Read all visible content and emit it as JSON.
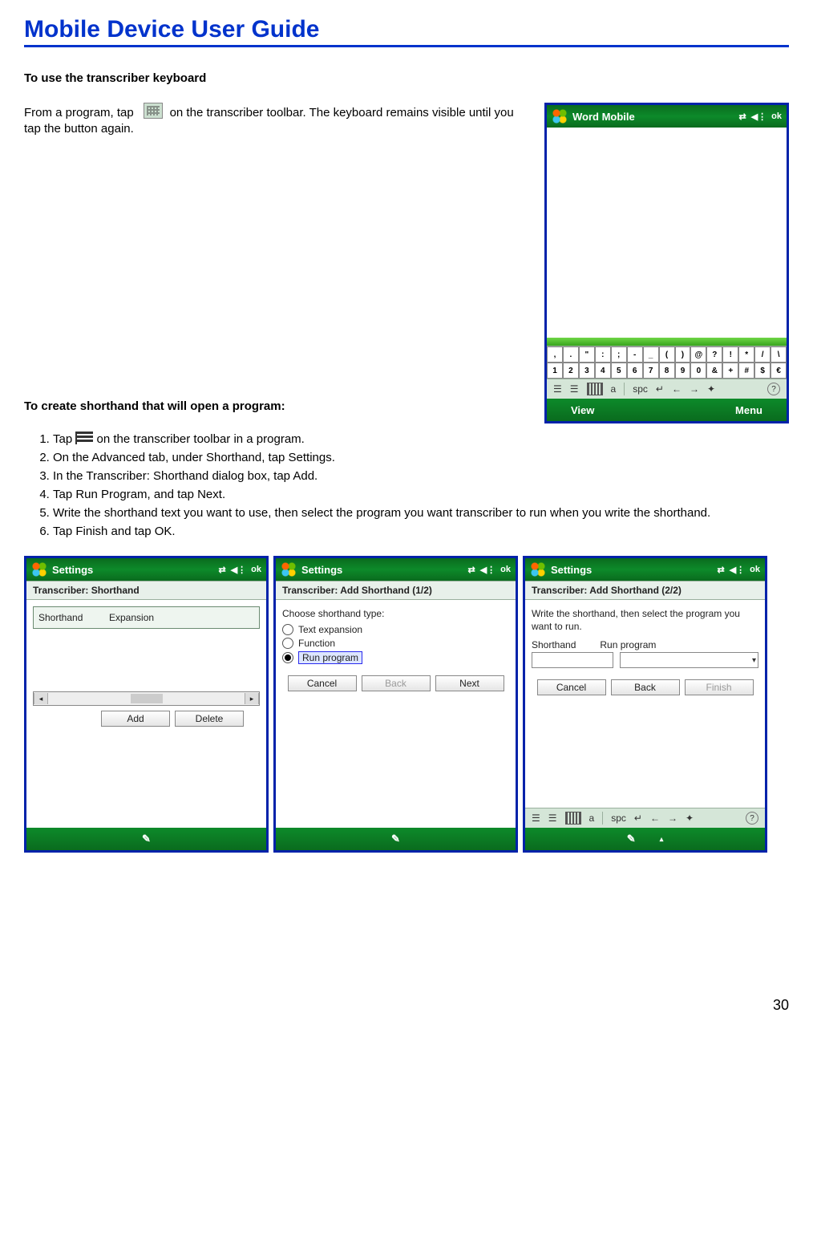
{
  "title": "Mobile Device User Guide",
  "sec1": "To use the transcriber keyboard",
  "para1a": "From a program, tap",
  "para1b": "on the transcriber toolbar. The keyboard remains visible until you tap the button again.",
  "sec2": "To create shorthand that will open a program:",
  "steps": [
    "Tap",
    "on the transcriber toolbar in a program.",
    "On the Advanced tab, under Shorthand, tap Settings.",
    "In the Transcriber: Shorthand dialog box, tap Add.",
    "Tap Run Program, and tap Next.",
    "Write the shorthand text you want to use, then select the program you want transcriber to run when you write the shorthand.",
    "Tap Finish and tap OK."
  ],
  "ok": "ok",
  "word": {
    "title": "Word Mobile",
    "view": "View",
    "menu": "Menu",
    "spc": "spc",
    "row1": [
      ",",
      ".",
      "\"",
      ":",
      ";",
      "-",
      "_",
      "(",
      ")",
      "@",
      "?",
      "!",
      "*",
      "/",
      "\\"
    ],
    "row2": [
      "1",
      "2",
      "3",
      "4",
      "5",
      "6",
      "7",
      "8",
      "9",
      "0",
      "&",
      "+",
      "#",
      "$",
      "€"
    ]
  },
  "s1": {
    "title": "Settings",
    "band": "Transcriber: Shorthand",
    "h1": "Shorthand",
    "h2": "Expansion",
    "add": "Add",
    "del": "Delete"
  },
  "s2": {
    "title": "Settings",
    "band": "Transcriber: Add Shorthand (1/2)",
    "prompt": "Choose shorthand type:",
    "o1": "Text expansion",
    "o2": "Function",
    "o3": "Run program",
    "cancel": "Cancel",
    "back": "Back",
    "next": "Next"
  },
  "s3": {
    "title": "Settings",
    "band": "Transcriber: Add Shorthand (2/2)",
    "prompt": "Write the shorthand, then select the program you want to run.",
    "h1": "Shorthand",
    "h2": "Run program",
    "cancel": "Cancel",
    "back": "Back",
    "finish": "Finish",
    "spc": "spc"
  },
  "page": "30",
  "glyph": {
    "conn": "⇄",
    "vol": "◀⋮",
    "kb": "⌨",
    "left": "←",
    "right": "→",
    "enter": "↵",
    "bullets": "☰",
    "help": "?",
    "a": "a",
    "tri": "✎"
  }
}
